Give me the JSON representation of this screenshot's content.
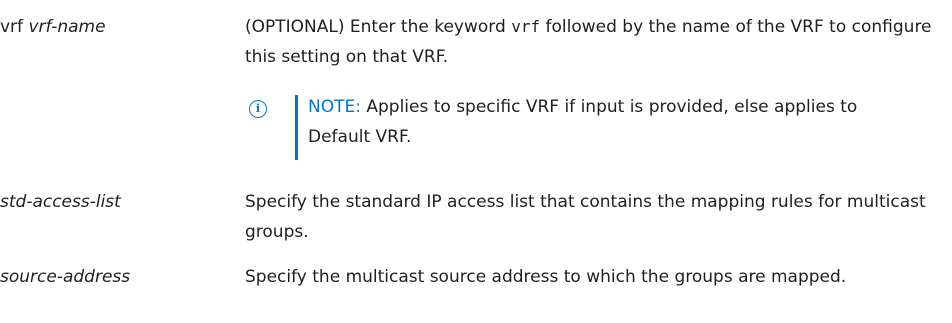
{
  "params": [
    {
      "term_prefix": "vrf",
      "term": "vrf-name",
      "desc_before": "(OPTIONAL) Enter the keyword ",
      "desc_code": "vrf",
      "desc_after": " followed by the name of the VRF to configure this setting on that VRF.",
      "note": {
        "icon": "info-icon",
        "label": "NOTE:",
        "text": " Applies to specific VRF if input is provided, else applies to Default VRF."
      }
    },
    {
      "term": "std-access-list",
      "desc": "Specify the standard IP access list that contains the mapping rules for multicast groups."
    },
    {
      "term": "source-address",
      "desc": "Specify the multicast source address to which the groups are mapped."
    }
  ],
  "colors": {
    "accent": "#0076ce",
    "text": "#1f1f1f"
  }
}
